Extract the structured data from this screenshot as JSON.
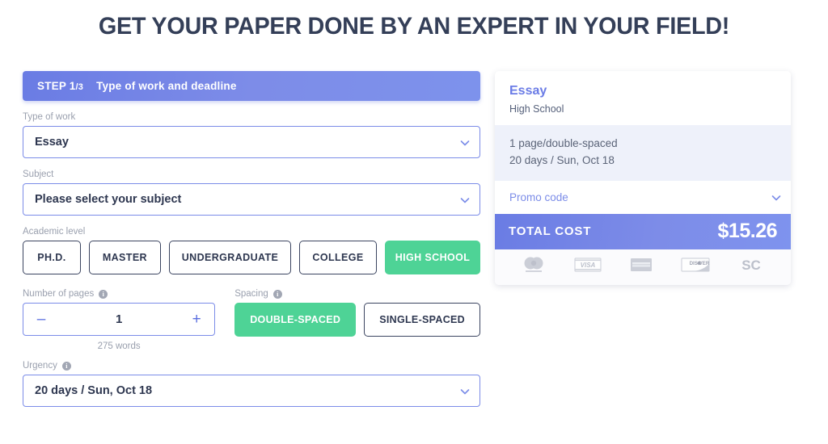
{
  "header": {
    "title": "GET YOUR PAPER DONE BY AN EXPERT IN YOUR FIELD!"
  },
  "step": {
    "label": "STEP 1",
    "fraction": "/3",
    "title": "Type of work and deadline"
  },
  "form": {
    "type_of_work": {
      "label": "Type of work",
      "value": "Essay",
      "chevron": "chevron-down-icon"
    },
    "subject": {
      "label": "Subject",
      "value": "Please select your subject",
      "chevron": "chevron-down-icon"
    },
    "academic_level": {
      "label": "Academic level",
      "options": [
        {
          "label": "PH.D.",
          "selected": false
        },
        {
          "label": "MASTER",
          "selected": false
        },
        {
          "label": "UNDERGRADUATE",
          "selected": false
        },
        {
          "label": "COLLEGE",
          "selected": false
        },
        {
          "label": "HIGH SCHOOL",
          "selected": true
        }
      ]
    },
    "pages": {
      "label": "Number of pages",
      "info_icon": "info-icon",
      "decrement": "–",
      "value": "1",
      "increment": "+",
      "words": "275 words"
    },
    "spacing": {
      "label": "Spacing",
      "info_icon": "info-icon",
      "options": [
        {
          "label": "DOUBLE-SPACED",
          "selected": true
        },
        {
          "label": "SINGLE-SPACED",
          "selected": false
        }
      ]
    },
    "urgency": {
      "label": "Urgency",
      "info_icon": "info-icon",
      "value": "20 days / Sun, Oct 18",
      "chevron": "chevron-down-icon"
    }
  },
  "summary": {
    "title": "Essay",
    "subtitle": "High School",
    "detail_line1": "1 page/double-spaced",
    "detail_line2": "20 days / Sun, Oct 18",
    "promo_label": "Promo code",
    "promo_chevron": "chevron-down-icon",
    "total_label": "TOTAL COST",
    "total_value": "$15.26",
    "payment_methods": [
      {
        "name": "mastercard-icon",
        "label": "mastercard"
      },
      {
        "name": "visa-icon",
        "label": "VISA"
      },
      {
        "name": "amex-icon",
        "label": "AMERICAN EXPRESS"
      },
      {
        "name": "discover-icon",
        "label": "DISCOVER"
      },
      {
        "name": "sc-icon",
        "label": "SC"
      }
    ]
  },
  "colors": {
    "accent_blue": "#7b8ce8",
    "accent_green": "#4ed396",
    "dark_navy": "#343f58",
    "muted_gray": "#9aa0ae",
    "panel_gray": "#eef1fa"
  }
}
